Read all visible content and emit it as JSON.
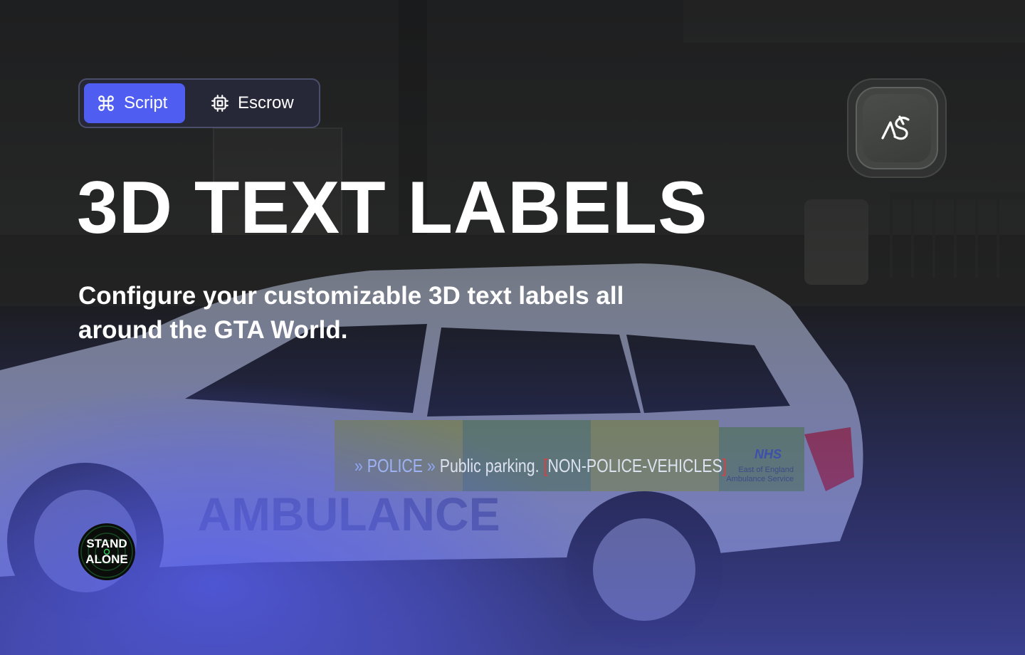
{
  "tabs": [
    {
      "label": "Script",
      "icon": "command-icon",
      "active": true
    },
    {
      "label": "Escrow",
      "icon": "chip-icon",
      "active": false
    }
  ],
  "logo": {
    "icon": "ns-logo-icon"
  },
  "hero": {
    "title": "3D TEXT LABELS",
    "subtitle": "Configure your customizable 3D text labels all around the GTA World."
  },
  "label3d": {
    "prefix": "»",
    "tag": "POLICE",
    "separator": "»",
    "text": "Public parking.",
    "bracket_open": "[",
    "highlight": "NON-POLICE-VEHICLES",
    "bracket_close": "]"
  },
  "vehicle": {
    "side_text": "AMBULANCE",
    "door_brand": "NHS",
    "door_line_1": "East of England",
    "door_line_2": "Ambulance Service"
  },
  "badge": {
    "line1": "STAND",
    "line2": "ALONE"
  },
  "colors": {
    "accent": "#4f5ef1",
    "glow": "#5860f0",
    "label_red": "#e23b3b",
    "background": "#16171a"
  }
}
